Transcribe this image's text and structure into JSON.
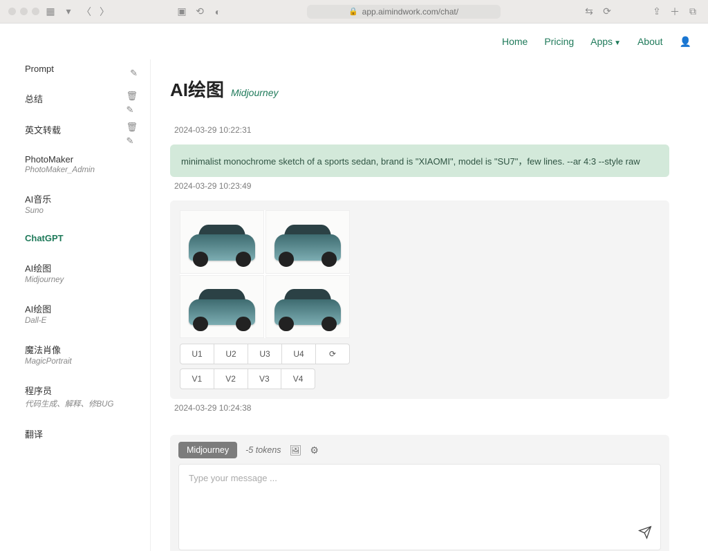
{
  "browser": {
    "url": "app.aimindwork.com/chat/"
  },
  "nav": {
    "home": "Home",
    "pricing": "Pricing",
    "apps": "Apps",
    "about": "About"
  },
  "sidebar": [
    {
      "title": "Prompt",
      "sub": "",
      "icons": [
        "edit"
      ],
      "truncated": true
    },
    {
      "title": "总结",
      "sub": "",
      "icons": [
        "delete",
        "edit"
      ]
    },
    {
      "title": "英文转载",
      "sub": "",
      "icons": [
        "delete",
        "edit"
      ]
    },
    {
      "title": "PhotoMaker",
      "sub": "PhotoMaker_Admin",
      "icons": []
    },
    {
      "title": "AI音乐",
      "sub": "Suno",
      "icons": []
    },
    {
      "title": "ChatGPT",
      "sub": "",
      "icons": [],
      "active": true
    },
    {
      "title": "AI绘图",
      "sub": "Midjourney",
      "icons": []
    },
    {
      "title": "AI绘图",
      "sub": "Dall-E",
      "icons": []
    },
    {
      "title": "魔法肖像",
      "sub": "MagicPortrait",
      "icons": []
    },
    {
      "title": "程序员",
      "sub": "代码生成、解释、修BUG",
      "icons": []
    },
    {
      "title": "翻译",
      "sub": "",
      "icons": []
    }
  ],
  "chat": {
    "title": "AI绘图",
    "model": "Midjourney",
    "msgs": {
      "ts1": "2024-03-29 10:22:31",
      "prompt": "minimalist monochrome sketch of a sports sedan, brand is \"XIAOMI\", model is \"SU7\"，few lines. --ar 4:3 --style raw",
      "ts2": "2024-03-29 10:23:49",
      "u_buttons": [
        "U1",
        "U2",
        "U3",
        "U4"
      ],
      "v_buttons": [
        "V1",
        "V2",
        "V3",
        "V4"
      ],
      "ts3": "2024-03-29 10:24:38"
    }
  },
  "composer": {
    "model_pill": "Midjourney",
    "tokens": "-5 tokens",
    "placeholder": "Type your message ..."
  }
}
